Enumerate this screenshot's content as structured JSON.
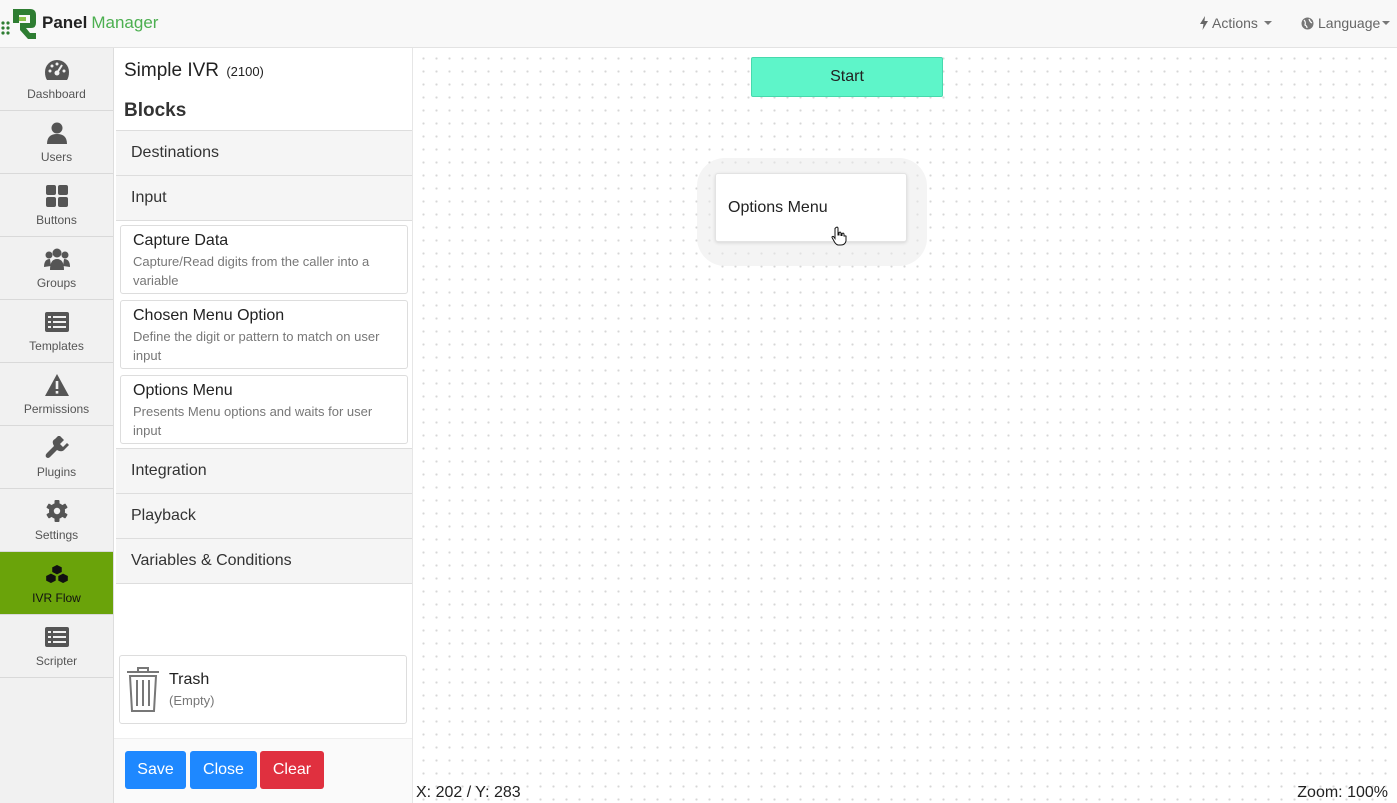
{
  "brand": {
    "name_bold": "Panel",
    "name_light": "Manager",
    "brand_color": "#4caf50"
  },
  "navbar": {
    "actions_label": "Actions",
    "language_label": "Language"
  },
  "sidebar": {
    "active_color": "#6aa30a",
    "items": [
      {
        "label": "Dashboard",
        "icon": "dashboard-icon"
      },
      {
        "label": "Users",
        "icon": "user-icon"
      },
      {
        "label": "Buttons",
        "icon": "grid-icon"
      },
      {
        "label": "Groups",
        "icon": "group-icon"
      },
      {
        "label": "Templates",
        "icon": "list-icon"
      },
      {
        "label": "Permissions",
        "icon": "warning-icon"
      },
      {
        "label": "Plugins",
        "icon": "plug-icon"
      },
      {
        "label": "Settings",
        "icon": "gear-icon"
      },
      {
        "label": "IVR Flow",
        "icon": "cubes-icon",
        "active": true
      },
      {
        "label": "Scripter",
        "icon": "list-icon"
      }
    ]
  },
  "panel": {
    "title": "Simple IVR",
    "title_id": "(2100)",
    "blocks_heading": "Blocks",
    "categories": {
      "destinations": "Destinations",
      "input": "Input",
      "integration": "Integration",
      "playback": "Playback",
      "variables": "Variables & Conditions"
    },
    "input_blocks": [
      {
        "title": "Capture Data",
        "desc": "Capture/Read digits from the caller into a variable"
      },
      {
        "title": "Chosen Menu Option",
        "desc": "Define the digit or pattern to match on user input"
      },
      {
        "title": "Options Menu",
        "desc": "Presents Menu options and waits for user input"
      }
    ],
    "trash": {
      "title": "Trash",
      "status": "(Empty)"
    },
    "buttons": {
      "save": "Save",
      "close": "Close",
      "clear": "Clear"
    }
  },
  "canvas": {
    "start_label": "Start",
    "start_color": "#5ef5c9",
    "node_label": "Options Menu",
    "coords": "X: 202 / Y: 283",
    "zoom": "Zoom: 100%"
  }
}
